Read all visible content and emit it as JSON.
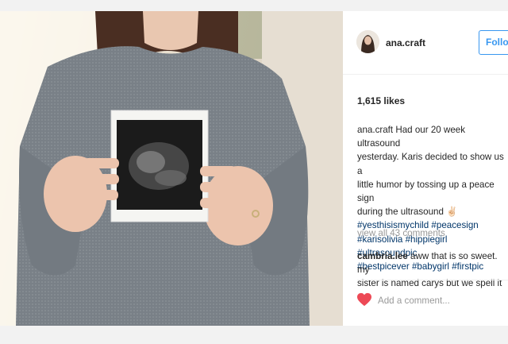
{
  "post": {
    "photo_description_icon": "ultrasound-photo-held-in-hands"
  },
  "header": {
    "username": "ana.craft",
    "follow_label": "Follo"
  },
  "likes": "1,615 likes",
  "caption": {
    "user": "ana.craft",
    "line1": "Had our 20 week ultrasound",
    "line2": "yesterday. Karis decided to show us a",
    "line3": "little humor by tossing up a peace sign",
    "line4": "during the ultrasound ✌🏻",
    "tags1": "#yesthisismychild #peacesign",
    "tags2": "#karisolivia #hippiegirl #ultrasoundpic",
    "tags3": "#bestpicever #babygirl #firstpic"
  },
  "view_all": "view all 43 comments",
  "comment": {
    "user": "cambria.lee",
    "text_line1": "aww that is so sweet. my",
    "text_line2": "sister is named carys but we spell it"
  },
  "add_comment": {
    "placeholder": "Add a comment..."
  },
  "colors": {
    "accent": "#3897f0",
    "heart": "#ed4956",
    "hashtag": "#003569",
    "muted": "#999999"
  }
}
